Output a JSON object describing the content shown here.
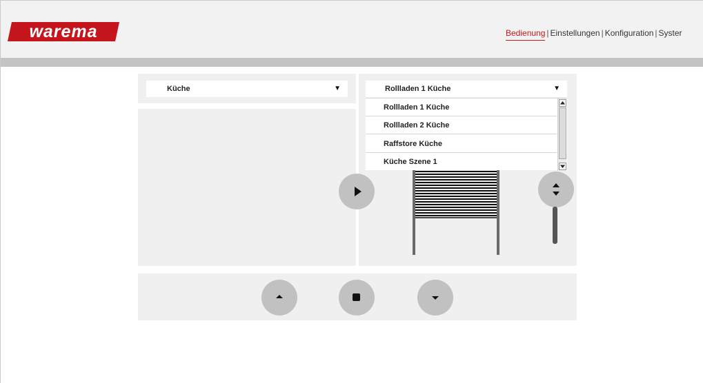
{
  "brand": {
    "logo_text": "warema",
    "color": "#c4161c"
  },
  "nav": {
    "items": [
      {
        "label": "Bedienung",
        "active": true
      },
      {
        "label": "Einstellungen",
        "active": false
      },
      {
        "label": "Konfiguration",
        "active": false
      },
      {
        "label": "Syster",
        "active": false
      }
    ],
    "separator": "|"
  },
  "room_select": {
    "value": "Küche"
  },
  "device_select": {
    "value": "Rollladen 1 Küche",
    "options": [
      "Rollladen 1 Küche",
      "Rollladen 2 Küche",
      "Raffstore Küche",
      "Küche Szene 1"
    ]
  },
  "controls": {
    "play": "play-icon",
    "up": "arrow-up-icon",
    "stop": "stop-icon",
    "down": "arrow-down-icon",
    "position": "up-down-icon"
  }
}
